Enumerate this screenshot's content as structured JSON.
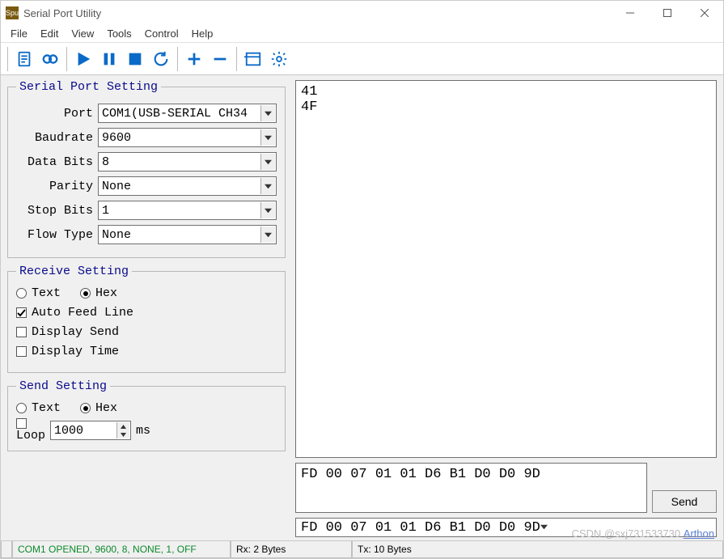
{
  "window": {
    "app_icon_text": "Spu",
    "title": "Serial Port Utility"
  },
  "menu": [
    "File",
    "Edit",
    "View",
    "Tools",
    "Control",
    "Help"
  ],
  "left": {
    "serial_port": {
      "legend": "Serial Port Setting",
      "port_label": "Port",
      "port_value": "COM1(USB-SERIAL CH34",
      "baud_label": "Baudrate",
      "baud_value": "9600",
      "databits_label": "Data Bits",
      "databits_value": "8",
      "parity_label": "Parity",
      "parity_value": "None",
      "stopbits_label": "Stop Bits",
      "stopbits_value": "1",
      "flow_label": "Flow Type",
      "flow_value": "None"
    },
    "receive": {
      "legend": "Receive Setting",
      "text_label": "Text",
      "hex_label": "Hex",
      "mode": "hex",
      "auto_feed_label": "Auto Feed Line",
      "auto_feed": true,
      "display_send_label": "Display Send",
      "display_send": false,
      "display_time_label": "Display Time",
      "display_time": false
    },
    "send": {
      "legend": "Send Setting",
      "text_label": "Text",
      "hex_label": "Hex",
      "mode": "hex",
      "loop_label": "Loop",
      "loop": false,
      "loop_interval": "1000",
      "loop_unit": "ms"
    }
  },
  "right": {
    "receive_text": "41\n4F",
    "send_text": "FD 00 07 01 01 D6 B1 D0 D0 9D",
    "send_btn": "Send",
    "history_value": "FD 00 07 01 01 D6 B1 D0 D0 9D"
  },
  "status": {
    "port": "COM1 OPENED, 9600, 8, NONE, 1, OFF",
    "rx": "Rx: 2 Bytes",
    "tx": "Tx: 10 Bytes"
  },
  "watermark": {
    "text": "CSDN @sxj731533730",
    "link": "Arthon"
  }
}
